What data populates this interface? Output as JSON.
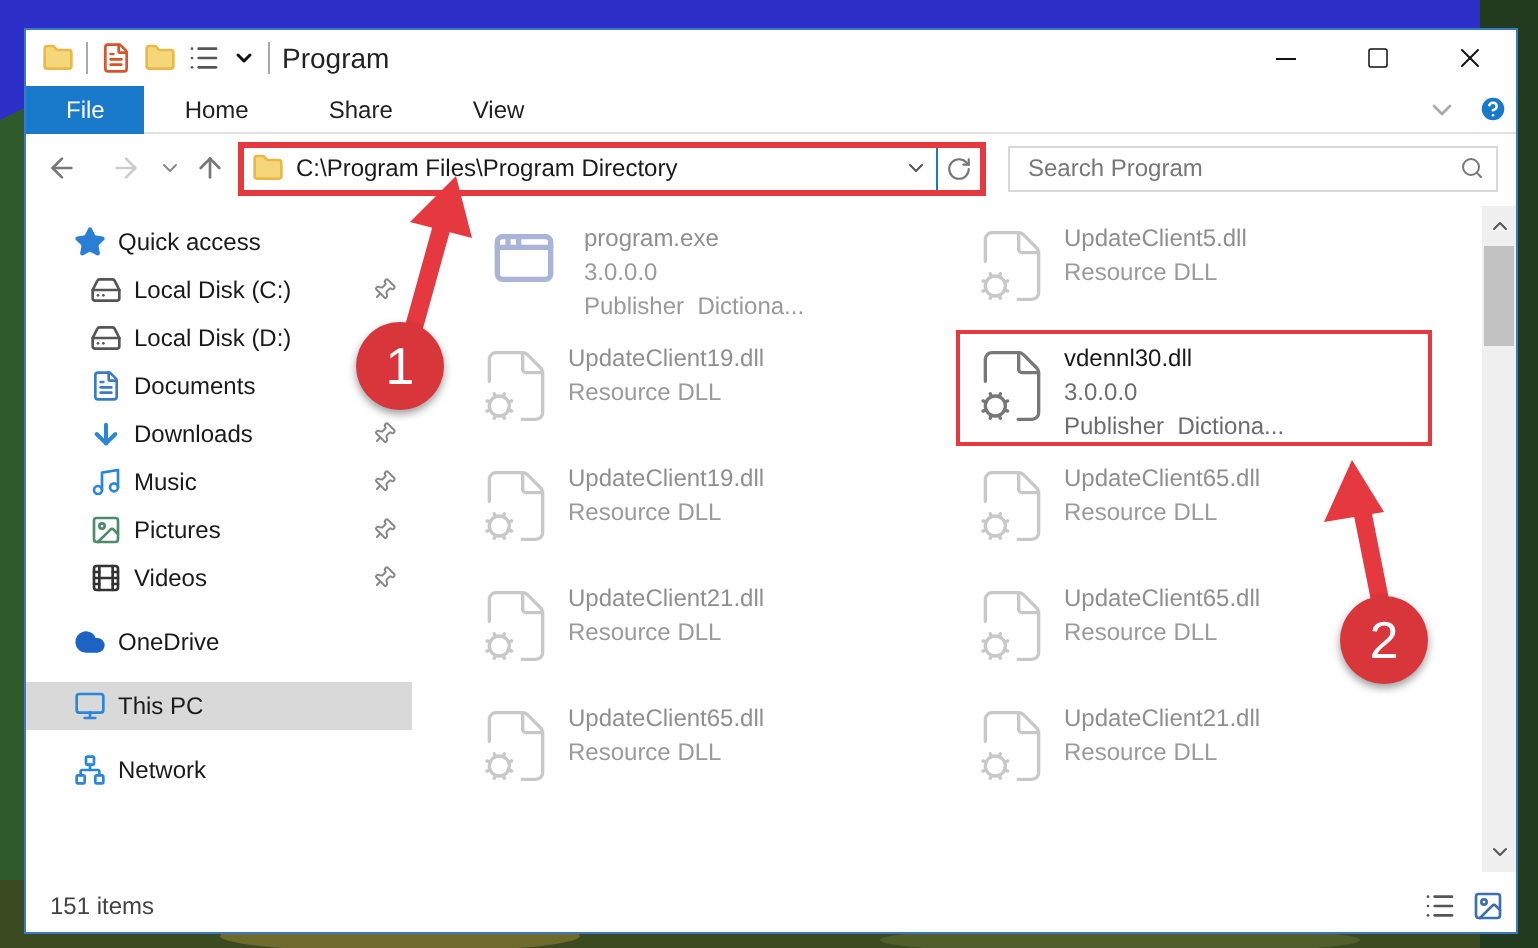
{
  "window": {
    "title": "Program"
  },
  "ribbon_tabs": [
    {
      "label": "File",
      "selected": true
    },
    {
      "label": "Home",
      "selected": false
    },
    {
      "label": "Share",
      "selected": false
    },
    {
      "label": "View",
      "selected": false
    }
  ],
  "address": {
    "path": "C:\\Program Files\\Program Directory",
    "marked": true
  },
  "search": {
    "placeholder": "Search Program"
  },
  "sidebar": {
    "items": [
      {
        "label": "Quick access",
        "kind": "quick-access",
        "selected": false,
        "pinned": false,
        "children": [
          {
            "label": "Local Disk (C:)",
            "kind": "system-drive",
            "selected": false,
            "pinned": true
          },
          {
            "label": "Local Disk (D:)",
            "kind": "drive",
            "selected": false,
            "pinned": false
          },
          {
            "label": "Documents",
            "kind": "documents",
            "selected": false,
            "pinned": false
          },
          {
            "label": "Downloads",
            "kind": "downloads",
            "selected": false,
            "pinned": true
          },
          {
            "label": "Music",
            "kind": "music",
            "selected": false,
            "pinned": true
          },
          {
            "label": "Pictures",
            "kind": "pictures",
            "selected": false,
            "pinned": true
          },
          {
            "label": "Videos",
            "kind": "videos",
            "selected": false,
            "pinned": true
          }
        ]
      },
      {
        "label": "OneDrive",
        "kind": "cloud",
        "selected": false,
        "pinned": false
      },
      {
        "label": "This PC",
        "kind": "pc",
        "selected": true,
        "pinned": false
      },
      {
        "label": "Network",
        "kind": "network",
        "selected": false,
        "pinned": false
      }
    ]
  },
  "files": [
    {
      "name": "program.exe",
      "details": [
        "3.0.0.0",
        "Publisher  Dictiona..."
      ],
      "kind": "exe",
      "faded": true,
      "marked": false
    },
    {
      "name": "UpdateClient5.dll",
      "details": [
        "Resource DLL"
      ],
      "kind": "dll",
      "faded": true,
      "marked": false
    },
    {
      "name": "UpdateClient19.dll",
      "details": [
        "Resource DLL"
      ],
      "kind": "dll",
      "faded": true,
      "marked": false
    },
    {
      "name": "vdennl30.dll",
      "details": [
        "3.0.0.0",
        "Publisher  Dictiona..."
      ],
      "kind": "dll",
      "faded": false,
      "marked": true
    },
    {
      "name": "UpdateClient19.dll",
      "details": [
        "Resource DLL"
      ],
      "kind": "dll",
      "faded": true,
      "marked": false
    },
    {
      "name": "UpdateClient65.dll",
      "details": [
        "Resource DLL"
      ],
      "kind": "dll",
      "faded": true,
      "marked": false
    },
    {
      "name": "UpdateClient21.dll",
      "details": [
        "Resource DLL"
      ],
      "kind": "dll",
      "faded": true,
      "marked": false
    },
    {
      "name": "UpdateClient65.dll",
      "details": [
        "Resource DLL"
      ],
      "kind": "dll",
      "faded": true,
      "marked": false
    },
    {
      "name": "UpdateClient65.dll",
      "details": [
        "Resource DLL"
      ],
      "kind": "dll",
      "faded": true,
      "marked": false
    },
    {
      "name": "UpdateClient21.dll",
      "details": [
        "Resource DLL"
      ],
      "kind": "dll",
      "faded": true,
      "marked": false
    }
  ],
  "status_bar": {
    "count": "151 items"
  },
  "callouts": [
    {
      "number": "1"
    },
    {
      "number": "2"
    }
  ]
}
